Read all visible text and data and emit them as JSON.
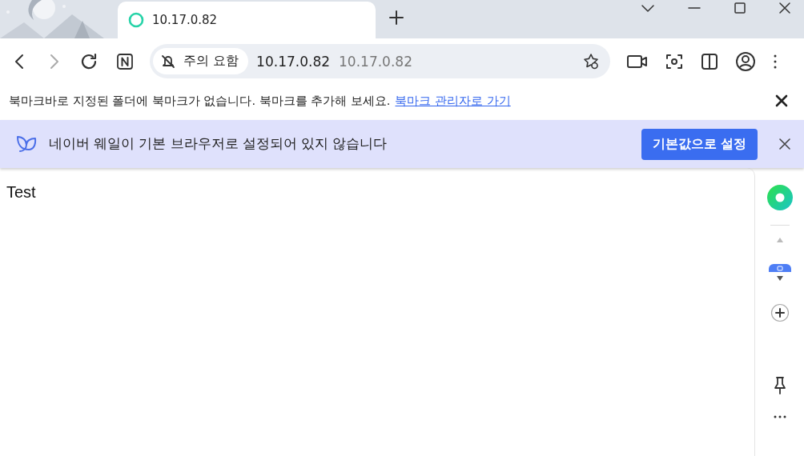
{
  "tab": {
    "title": "10.17.0.82",
    "selected": true
  },
  "toolbar": {
    "security_badge": "주의 요함",
    "url_host": "10.17.0.82",
    "url_path": "10.17.0.82"
  },
  "bookmark_bar": {
    "message": "북마크바로 지정된 폴더에 북마크가 없습니다. 북마크를 추가해 보세요.",
    "link": "북마크 관리자로 가기"
  },
  "infobar": {
    "message": "네이버 웨일이 기본 브라우저로 설정되어 있지 않습니다",
    "button": "기본값으로 설정"
  },
  "page": {
    "text": "Test"
  }
}
